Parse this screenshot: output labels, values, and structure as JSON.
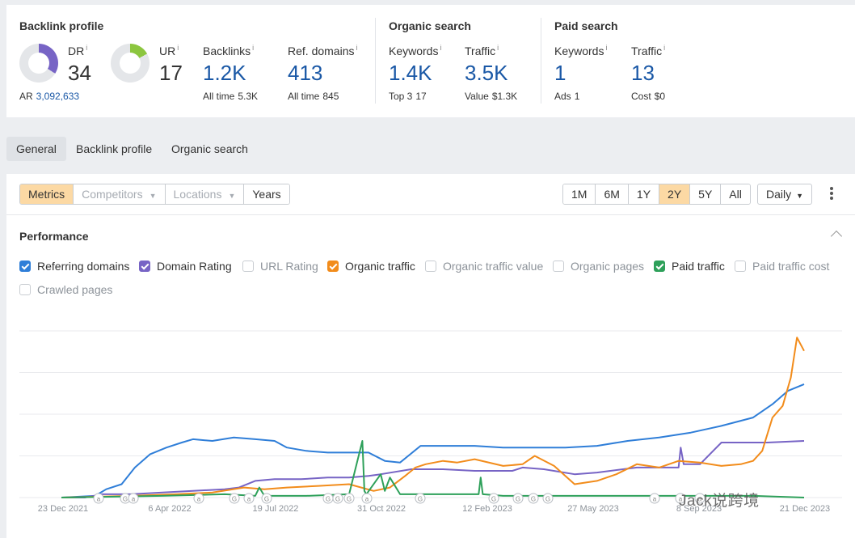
{
  "summary": {
    "backlink_profile": {
      "title": "Backlink profile",
      "dr": {
        "label": "DR",
        "value": "34",
        "fraction": 0.34
      },
      "ur": {
        "label": "UR",
        "value": "17",
        "fraction": 0.17
      },
      "ar_label": "AR",
      "ar_value": "3,092,633",
      "backlinks": {
        "label": "Backlinks",
        "value": "1.2K",
        "sub_label": "All time",
        "sub_value": "5.3K"
      },
      "ref_domains": {
        "label": "Ref. domains",
        "value": "413",
        "sub_label": "All time",
        "sub_value": "845"
      }
    },
    "organic_search": {
      "title": "Organic search",
      "keywords": {
        "label": "Keywords",
        "value": "1.4K",
        "sub_label": "Top 3",
        "sub_value": "17"
      },
      "traffic": {
        "label": "Traffic",
        "value": "3.5K",
        "sub_label": "Value",
        "sub_value": "$1.3K"
      }
    },
    "paid_search": {
      "title": "Paid search",
      "keywords": {
        "label": "Keywords",
        "value": "1",
        "sub_label": "Ads",
        "sub_value": "1"
      },
      "traffic": {
        "label": "Traffic",
        "value": "13",
        "sub_label": "Cost",
        "sub_value": "$0"
      }
    },
    "info_marker": "i"
  },
  "tabs": [
    {
      "label": "General",
      "active": true
    },
    {
      "label": "Backlink profile",
      "active": false
    },
    {
      "label": "Organic search",
      "active": false
    }
  ],
  "toolbar": {
    "metrics": "Metrics",
    "competitors": "Competitors",
    "locations": "Locations",
    "years": "Years",
    "ranges": [
      "1M",
      "6M",
      "1Y",
      "2Y",
      "5Y",
      "All"
    ],
    "selected_range": "2Y",
    "granularity": "Daily"
  },
  "performance": {
    "title": "Performance",
    "checkboxes": [
      {
        "label": "Referring domains",
        "checked": true,
        "color": "#2f7ed8"
      },
      {
        "label": "Domain Rating",
        "checked": true,
        "color": "#7764c5"
      },
      {
        "label": "URL Rating",
        "checked": false,
        "color": ""
      },
      {
        "label": "Organic traffic",
        "checked": true,
        "color": "#f28c1b"
      },
      {
        "label": "Organic traffic value",
        "checked": false,
        "color": ""
      },
      {
        "label": "Organic pages",
        "checked": false,
        "color": ""
      },
      {
        "label": "Paid traffic",
        "checked": true,
        "color": "#2ea05a"
      },
      {
        "label": "Paid traffic cost",
        "checked": false,
        "color": ""
      },
      {
        "label": "Crawled pages",
        "checked": false,
        "color": ""
      }
    ]
  },
  "chart_data": {
    "type": "line",
    "x_ticks": [
      "23 Dec 2021",
      "6 Apr 2022",
      "19 Jul 2022",
      "31 Oct 2022",
      "12 Feb 2023",
      "27 May 2023",
      "8 Sep 2023",
      "21 Dec 2023"
    ],
    "x_range": [
      "2021-12-23",
      "2023-12-21"
    ],
    "y_relative_range": [
      0,
      100
    ],
    "grid": "horizontal",
    "annotation_markers": [
      "a",
      "G",
      "a",
      "a",
      "G",
      "a",
      "G",
      "G",
      "G",
      "G",
      "a",
      "G",
      "G",
      "G",
      "G",
      "G",
      "a",
      "a",
      "a"
    ],
    "series": [
      {
        "name": "Referring domains",
        "color": "#2f7ed8",
        "x": [
          "2021-12-23",
          "2022-01-25",
          "2022-02-05",
          "2022-02-20",
          "2022-03-05",
          "2022-03-20",
          "2022-04-05",
          "2022-04-20",
          "2022-05-01",
          "2022-05-20",
          "2022-06-10",
          "2022-07-01",
          "2022-07-20",
          "2022-08-01",
          "2022-08-20",
          "2022-09-10",
          "2022-09-30",
          "2022-10-20",
          "2022-11-05",
          "2022-11-20",
          "2022-12-10",
          "2023-01-01",
          "2023-02-01",
          "2023-03-01",
          "2023-04-01",
          "2023-05-01",
          "2023-06-01",
          "2023-07-01",
          "2023-08-01",
          "2023-09-01",
          "2023-10-01",
          "2023-11-01",
          "2023-11-20",
          "2023-12-05",
          "2023-12-21"
        ],
        "values": [
          0,
          1,
          5,
          8,
          18,
          26,
          30,
          33,
          35,
          34,
          36,
          35,
          34,
          30,
          28,
          27,
          27,
          27,
          22,
          21,
          31,
          31,
          31,
          30,
          30,
          30,
          31,
          34,
          36,
          39,
          43,
          48,
          56,
          64,
          68
        ]
      },
      {
        "name": "Domain Rating",
        "color": "#7764c5",
        "x": [
          "2021-12-23",
          "2022-01-15",
          "2022-02-01",
          "2022-03-01",
          "2022-04-01",
          "2022-05-01",
          "2022-06-01",
          "2022-06-15",
          "2022-07-01",
          "2022-07-20",
          "2022-08-15",
          "2022-09-10",
          "2022-10-01",
          "2022-10-20",
          "2022-11-01",
          "2022-12-01",
          "2023-01-01",
          "2023-02-01",
          "2023-03-10",
          "2023-03-20",
          "2023-04-10",
          "2023-05-10",
          "2023-06-01",
          "2023-07-10",
          "2023-08-01",
          "2023-08-20",
          "2023-08-22",
          "2023-08-25",
          "2023-09-10",
          "2023-10-01",
          "2023-10-20",
          "2023-11-15",
          "2023-12-21"
        ],
        "values": [
          0,
          0,
          2,
          2,
          3,
          4,
          5,
          6,
          10,
          11,
          11,
          12,
          12,
          13,
          14,
          17,
          17,
          16,
          16,
          18,
          17,
          14,
          15,
          18,
          18,
          18,
          30,
          20,
          20,
          33,
          33,
          33,
          34
        ]
      },
      {
        "name": "Organic traffic",
        "color": "#f28c1b",
        "x": [
          "2021-12-23",
          "2022-03-01",
          "2022-04-15",
          "2022-05-20",
          "2022-06-20",
          "2022-07-10",
          "2022-08-01",
          "2022-09-01",
          "2022-10-01",
          "2022-10-25",
          "2022-11-10",
          "2022-11-25",
          "2022-12-05",
          "2022-12-15",
          "2023-01-01",
          "2023-01-15",
          "2023-02-01",
          "2023-03-01",
          "2023-03-20",
          "2023-04-01",
          "2023-04-20",
          "2023-05-10",
          "2023-06-01",
          "2023-06-20",
          "2023-07-10",
          "2023-08-01",
          "2023-08-20",
          "2023-09-10",
          "2023-10-01",
          "2023-10-20",
          "2023-11-01",
          "2023-11-10",
          "2023-11-20",
          "2023-11-30",
          "2023-12-08",
          "2023-12-14",
          "2023-12-21"
        ],
        "values": [
          0,
          1,
          2,
          3,
          6,
          5,
          6,
          7,
          8,
          4,
          6,
          13,
          18,
          20,
          22,
          21,
          23,
          19,
          20,
          25,
          19,
          8,
          10,
          14,
          20,
          18,
          22,
          21,
          19,
          20,
          22,
          28,
          48,
          55,
          72,
          96,
          88
        ]
      },
      {
        "name": "Paid traffic",
        "color": "#2ea05a",
        "x": [
          "2021-12-23",
          "2022-04-01",
          "2022-06-01",
          "2022-07-01",
          "2022-07-05",
          "2022-07-10",
          "2022-08-20",
          "2022-10-01",
          "2022-10-14",
          "2022-10-16",
          "2022-10-18",
          "2022-11-01",
          "2022-11-05",
          "2022-11-10",
          "2022-11-20",
          "2022-12-01",
          "2023-01-01",
          "2023-02-05",
          "2023-02-07",
          "2023-02-09",
          "2023-03-01",
          "2023-05-01",
          "2023-07-01",
          "2023-09-01",
          "2023-10-01",
          "2023-11-01",
          "2023-12-21"
        ],
        "values": [
          0,
          1,
          2,
          1,
          6,
          1,
          1,
          2,
          34,
          4,
          2,
          14,
          4,
          12,
          2,
          2,
          2,
          2,
          12,
          2,
          1,
          1,
          1,
          1,
          1,
          1,
          0
        ]
      }
    ]
  },
  "watermark": "Jack说跨境"
}
